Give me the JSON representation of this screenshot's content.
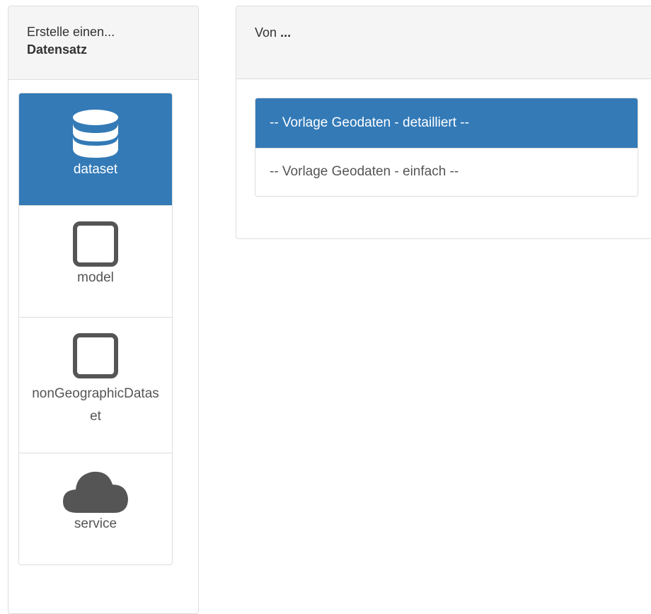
{
  "create_panel": {
    "heading_prefix": "Erstelle einen...",
    "heading_value": "Datensatz"
  },
  "types": [
    {
      "label": "dataset",
      "icon": "database-icon",
      "active": true
    },
    {
      "label": "model",
      "icon": "square-icon",
      "active": false
    },
    {
      "label": "nonGeographicDataset",
      "icon": "square-icon",
      "active": false
    },
    {
      "label": "service",
      "icon": "cloud-icon",
      "active": false
    }
  ],
  "from_panel": {
    "heading_prefix": "Von",
    "heading_value": "..."
  },
  "templates": [
    {
      "label": "-- Vorlage Geodaten - detailliert --",
      "active": true
    },
    {
      "label": "-- Vorlage Geodaten - einfach --",
      "active": false
    }
  ],
  "colors": {
    "accent": "#337ab7",
    "icon_gray": "#555555",
    "panel_heading_bg": "#f5f5f5",
    "border": "#dddddd"
  }
}
